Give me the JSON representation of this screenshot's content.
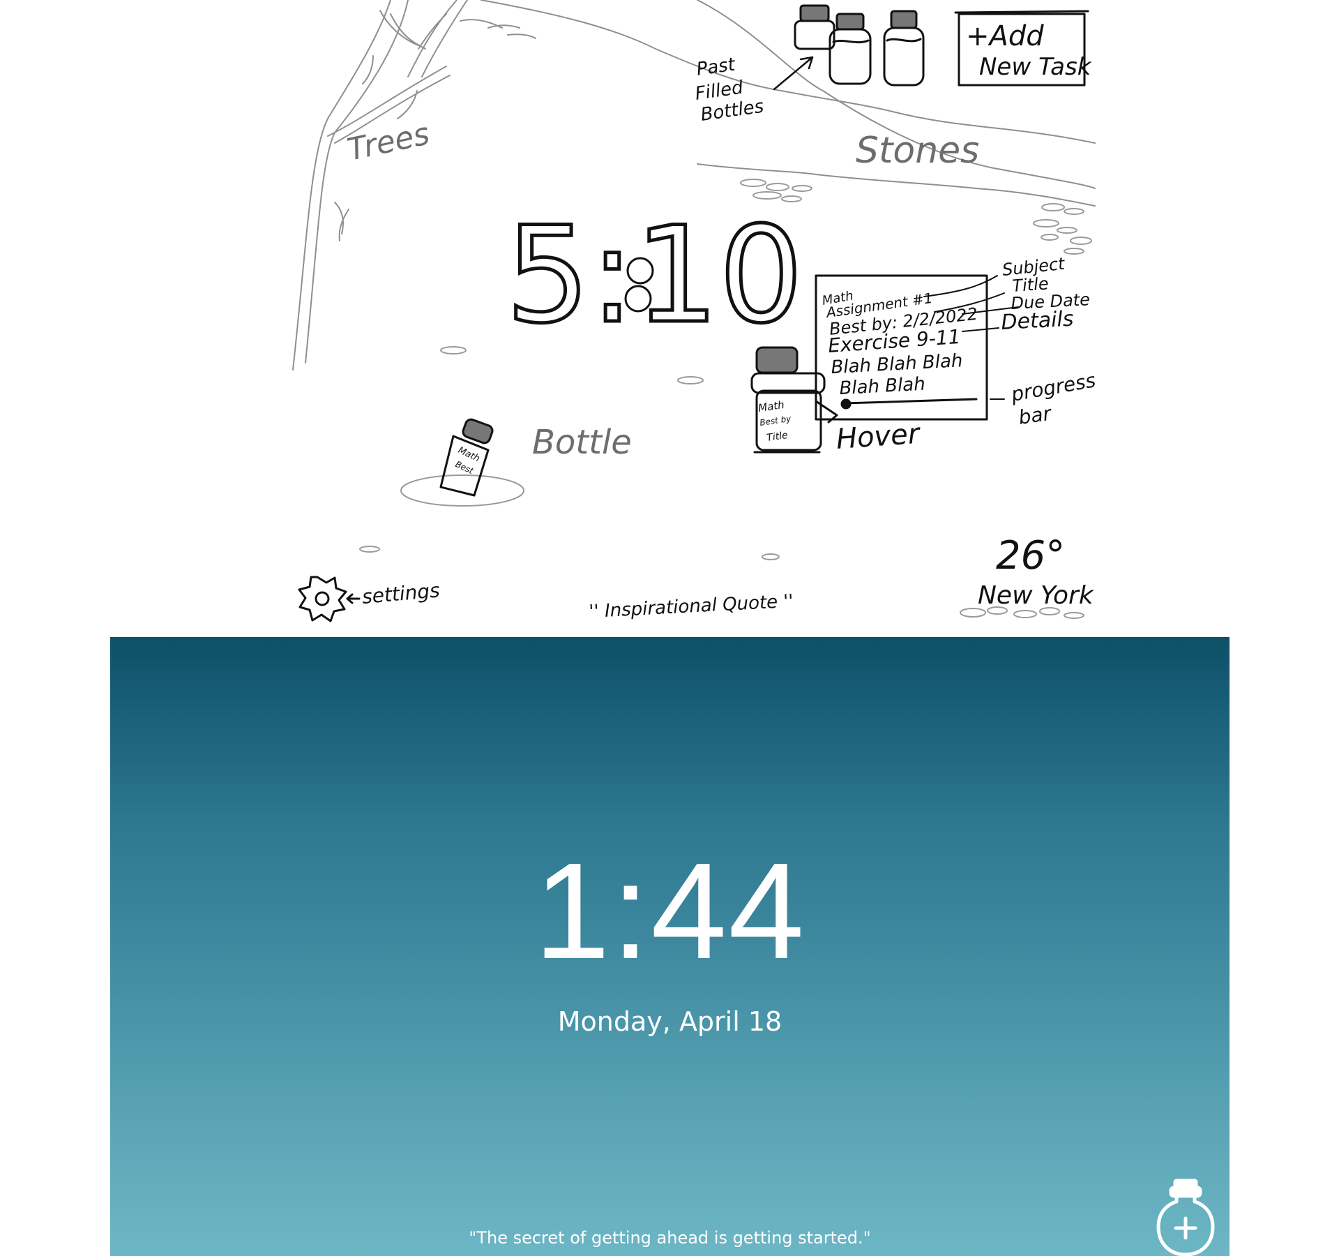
{
  "sketch": {
    "labels": {
      "past_filled_bottles": [
        "Past",
        "Filled",
        "Bottles"
      ],
      "add_task": [
        "+Add",
        "New Task"
      ],
      "trees": "Trees",
      "stones": "Stones",
      "clock": "5:10",
      "bottle": "Bottle",
      "hover": "Hover",
      "settings": "settings",
      "quote": "'' Inspirational Quote ''",
      "temperature": "26°",
      "city": "New York"
    },
    "card": {
      "subject": "Math",
      "title": "Assignment #1",
      "best_by": "Best by: 2/2/2022",
      "details_title": "Exercise 9-11",
      "details_line1": "Blah Blah Blah",
      "details_line2": "Blah Blah"
    },
    "annotations": {
      "subject": "Subject",
      "title": "Title",
      "due_date": "Due Date",
      "details": "Details",
      "progress_bar": [
        "progress",
        "bar"
      ]
    },
    "bottle_labels": {
      "small": [
        "Math",
        "Best"
      ],
      "hover": [
        "Math",
        "Best by",
        "Title"
      ]
    }
  },
  "app": {
    "time": "1:44",
    "date": "Monday, April 18",
    "quote": "\"The secret of getting ahead is getting started.\"",
    "add_bottle_icon": "bottle-plus-icon",
    "colors": {
      "gradient_top": "#0d5068",
      "gradient_bottom": "#6cb6c5",
      "text": "#ffffff"
    }
  }
}
